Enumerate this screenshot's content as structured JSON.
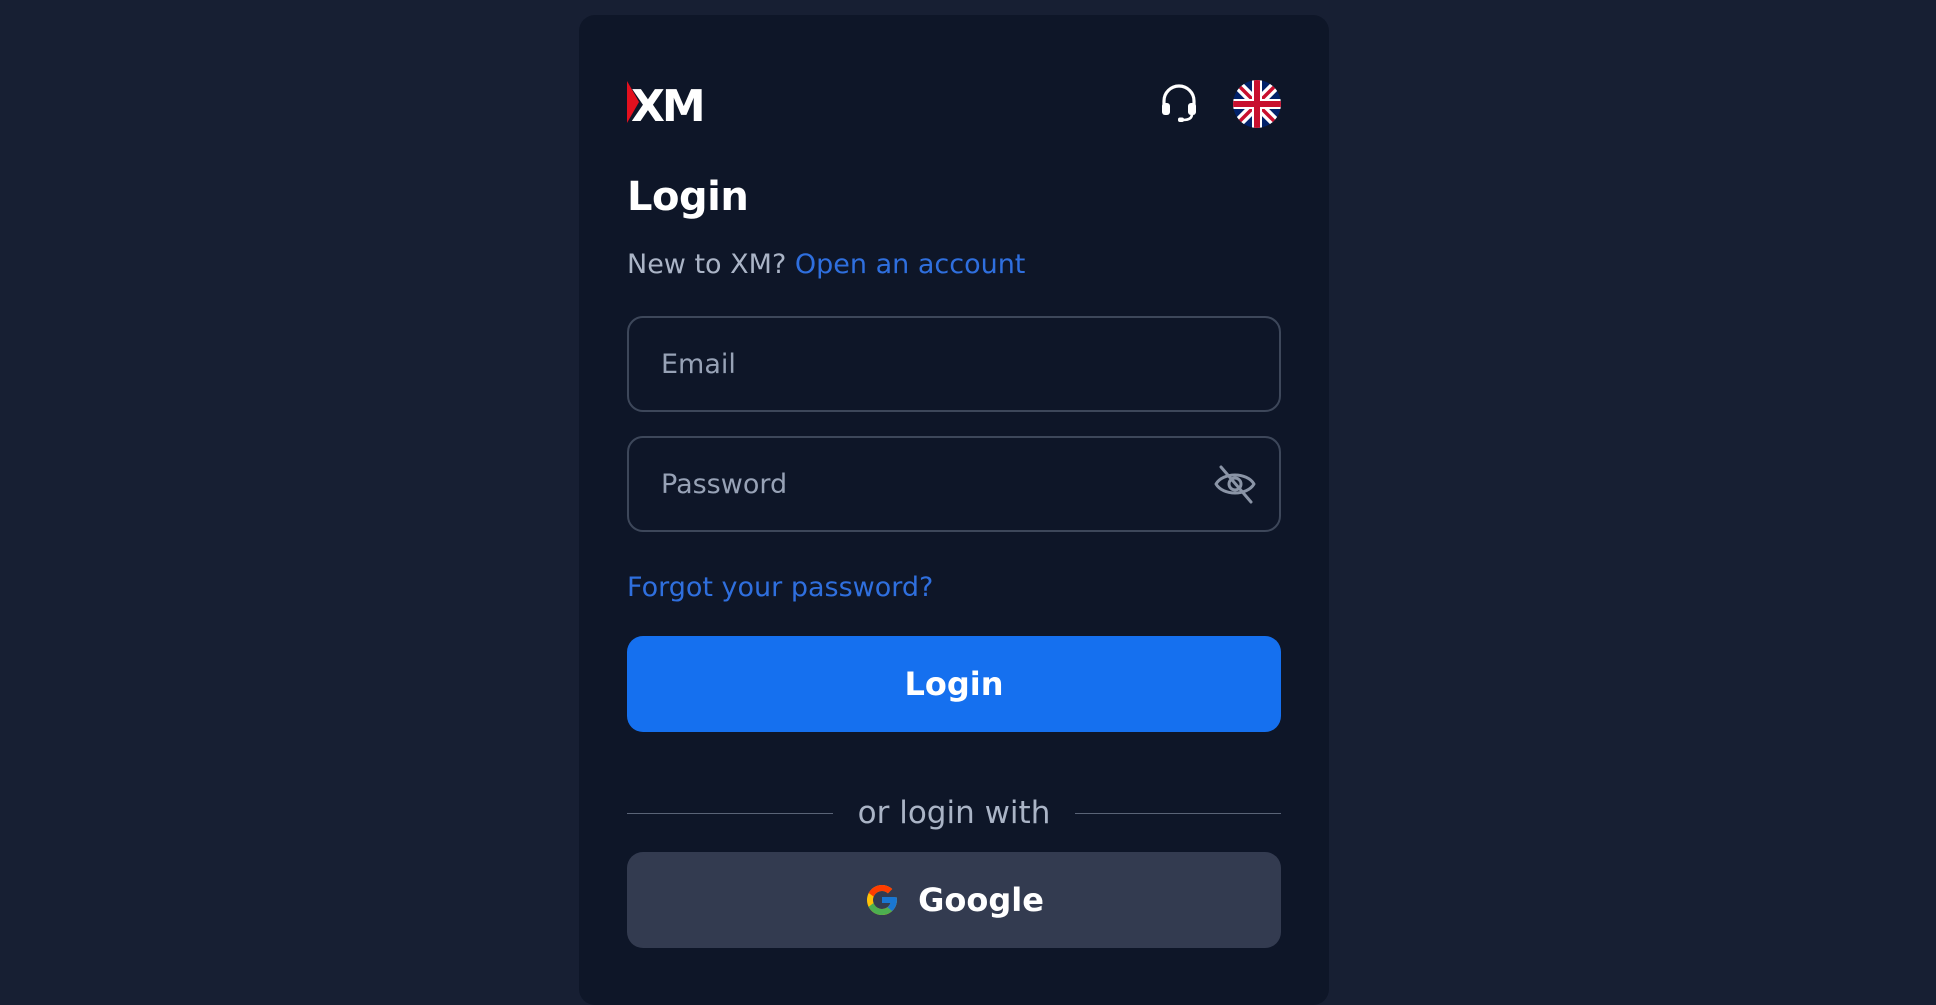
{
  "header": {
    "logo_text": "XM",
    "support_icon": "headset-icon",
    "language_icon": "uk-flag-icon"
  },
  "login": {
    "title": "Login",
    "new_prompt": "New to XM?",
    "open_account_link": "Open an account",
    "email_placeholder": "Email",
    "password_placeholder": "Password",
    "password_toggle_icon": "eye-off-icon",
    "forgot_link": "Forgot your password?",
    "submit_label": "Login",
    "divider_text": "or login with",
    "google_label": "Google",
    "google_icon": "google-icon"
  },
  "colors": {
    "page_bg": "#171f33",
    "card_bg": "#0e1628",
    "accent": "#1570ef",
    "link": "#2f6fde",
    "logo_red": "#e3101e",
    "social_button_bg": "#333b50"
  }
}
